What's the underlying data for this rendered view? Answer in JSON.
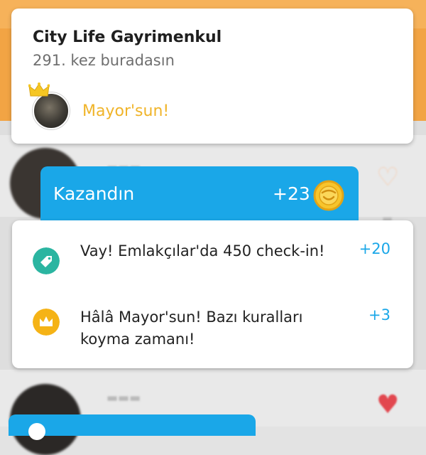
{
  "venue": {
    "name": "City Life Gayrimenkul",
    "visit_count": "291. kez buradasın",
    "mayor_label": "Mayor'sun!"
  },
  "earned": {
    "title": "Kazandın",
    "total": "+23"
  },
  "rewards": [
    {
      "icon": "tag-icon",
      "text": "Vay! Emlakçılar'da 450 check-in!",
      "points": "+20",
      "color": "#2bb5a1"
    },
    {
      "icon": "crown-icon",
      "text": "Hâlâ Mayor'sun! Bazı kuralları koyma zamanı!",
      "points": "+3",
      "color": "#f5b316"
    }
  ],
  "colors": {
    "accent_blue": "#1aa7e8",
    "mayor_gold": "#f0b429",
    "header_orange": "#f2a444"
  }
}
